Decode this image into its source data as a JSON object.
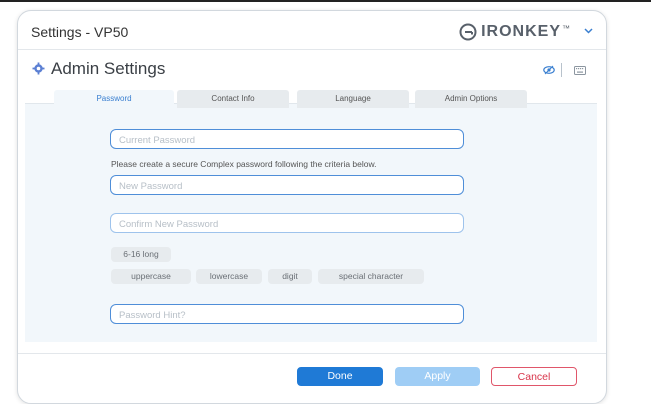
{
  "window": {
    "title": "Settings - VP50"
  },
  "brand": {
    "name": "IRONKEY",
    "tm": "™"
  },
  "header": {
    "title": "Admin Settings"
  },
  "tabs": [
    {
      "label": "Password",
      "active": true
    },
    {
      "label": "Contact Info",
      "active": false
    },
    {
      "label": "Language",
      "active": false
    },
    {
      "label": "Admin Options",
      "active": false
    }
  ],
  "form": {
    "current_password_placeholder": "Current Password",
    "instructions": "Please create a secure Complex password following the criteria below.",
    "new_password_placeholder": "New Password",
    "confirm_password_placeholder": "Confirm New Password",
    "hint_placeholder": "Password Hint?"
  },
  "criteria": {
    "length": "6-16 long",
    "items": [
      "uppercase",
      "lowercase",
      "digit",
      "special character"
    ]
  },
  "buttons": {
    "done": "Done",
    "apply": "Apply",
    "cancel": "Cancel"
  },
  "colors": {
    "accent": "#1f7ad6",
    "apply_disabled": "#9fcdf5",
    "cancel": "#d8344a",
    "field_border": "#4f8ed8"
  },
  "icons": [
    "ironkey-logo-icon",
    "chevron-down-icon",
    "gear-icon",
    "eye-icon",
    "keyboard-icon"
  ]
}
